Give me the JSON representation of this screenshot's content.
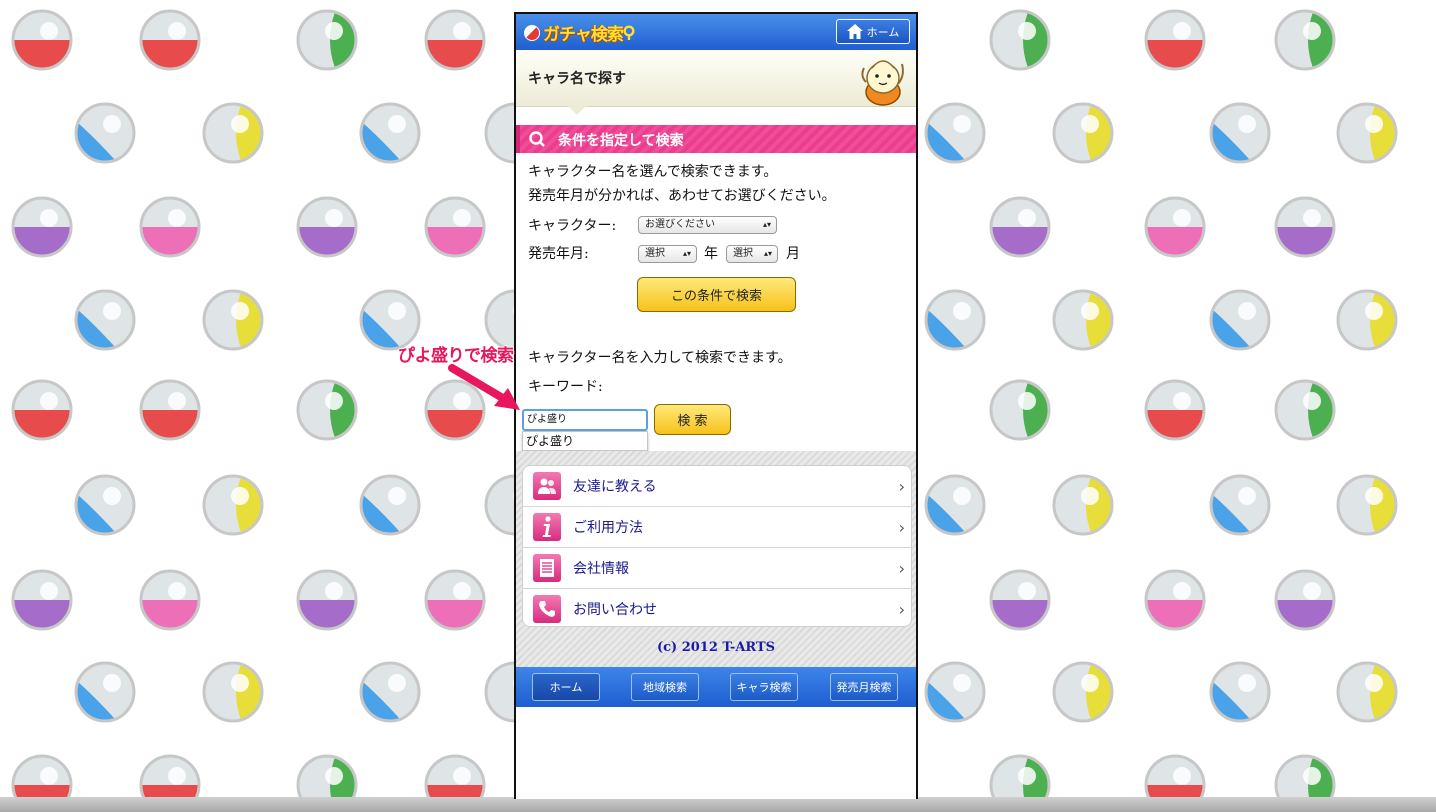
{
  "header": {
    "logo_text": "ガチャ検索",
    "home_label": "ホーム"
  },
  "subheader": {
    "title": "キャラ名で探す"
  },
  "section": {
    "title": "条件を指定して検索"
  },
  "search_by_select": {
    "intro_line1": "キャラクター名を選んで検索できます。",
    "intro_line2": "発売年月が分かれば、あわせてお選びください。",
    "character_label": "キャラクター:",
    "character_value": "お選びください",
    "date_label": "発売年月:",
    "year_value": "選択",
    "year_suffix": "年",
    "month_value": "選択",
    "month_suffix": "月",
    "submit_label": "この条件で検索"
  },
  "search_by_keyword": {
    "intro": "キャラクター名を入力して検索できます。",
    "keyword_label": "キーワード:",
    "input_value": "ぴよ盛り",
    "suggestion": "ぴよ盛り",
    "submit_label": "検 索"
  },
  "annotation": {
    "text": "ぴよ盛りで検索",
    "color": "#e8175d"
  },
  "menu": {
    "items": [
      {
        "label": "友達に教える",
        "icon": "users-icon"
      },
      {
        "label": "ご利用方法",
        "icon": "info-icon"
      },
      {
        "label": "会社情報",
        "icon": "document-icon"
      },
      {
        "label": "お問い合わせ",
        "icon": "phone-icon"
      }
    ]
  },
  "copyright": "(c) 2012 T-ARTS",
  "footer": {
    "tabs": [
      {
        "label": "ホーム"
      },
      {
        "label": "地域検索"
      },
      {
        "label": "キャラ検索"
      },
      {
        "label": "発売月検索"
      }
    ]
  },
  "colors": {
    "header_blue": "#2a6fdc",
    "section_pink": "#ec4792",
    "button_yellow": "#f8d23a",
    "link_navy": "#1a1a8a"
  }
}
